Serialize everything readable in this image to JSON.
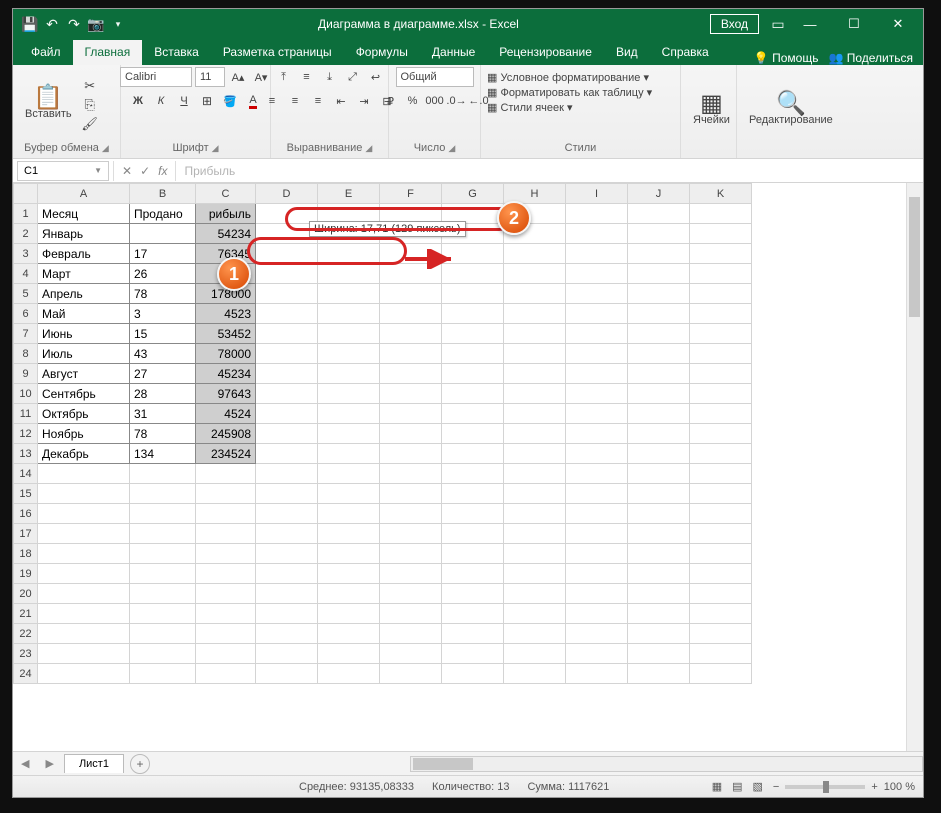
{
  "window": {
    "title": "Диаграмма в диаграмме.xlsx - Excel",
    "login": "Вход"
  },
  "tabs": {
    "file": "Файл",
    "home": "Главная",
    "insert": "Вставка",
    "layout": "Разметка страницы",
    "formulas": "Формулы",
    "data": "Данные",
    "review": "Рецензирование",
    "view": "Вид",
    "help": "Справка",
    "tellme": "Помощь",
    "share": "Поделиться"
  },
  "ribbon": {
    "paste": "Вставить",
    "clipboard": "Буфер обмена",
    "fontname": "Calibri",
    "fontsize": "11",
    "font": "Шрифт",
    "align": "Выравнивание",
    "numberfmt": "Общий",
    "number": "Число",
    "condfmt": "Условное форматирование",
    "fmttable": "Форматировать как таблицу",
    "cellstyles": "Стили ячеек",
    "styles": "Стили",
    "cells": "Ячейки",
    "editing": "Редактирование"
  },
  "namebox": "C1",
  "formula": "Прибыль",
  "tooltip": "Ширина: 17,71 (129 пиксель)",
  "markers": {
    "m1": "1",
    "m2": "2"
  },
  "columns": [
    "A",
    "B",
    "C",
    "D",
    "E",
    "F",
    "G",
    "H",
    "I",
    "J",
    "K"
  ],
  "rows": [
    {
      "a": "Месяц",
      "b": "Продано",
      "c": "рибыль"
    },
    {
      "a": "Январь",
      "b": "",
      "c": "54234"
    },
    {
      "a": "Февраль",
      "b": "17",
      "c": "76345"
    },
    {
      "a": "Март",
      "b": "26",
      "c": "45234"
    },
    {
      "a": "Апрель",
      "b": "78",
      "c": "178000"
    },
    {
      "a": "Май",
      "b": "3",
      "c": "4523"
    },
    {
      "a": "Июнь",
      "b": "15",
      "c": "53452"
    },
    {
      "a": "Июль",
      "b": "43",
      "c": "78000"
    },
    {
      "a": "Август",
      "b": "27",
      "c": "45234"
    },
    {
      "a": "Сентябрь",
      "b": "28",
      "c": "97643"
    },
    {
      "a": "Октябрь",
      "b": "31",
      "c": "4524"
    },
    {
      "a": "Ноябрь",
      "b": "78",
      "c": "245908"
    },
    {
      "a": "Декабрь",
      "b": "134",
      "c": "234524"
    }
  ],
  "sheet": "Лист1",
  "status": {
    "avg_label": "Среднее:",
    "avg": "93135,08333",
    "count_label": "Количество:",
    "count": "13",
    "sum_label": "Сумма:",
    "sum": "1117621",
    "zoom": "100 %"
  }
}
